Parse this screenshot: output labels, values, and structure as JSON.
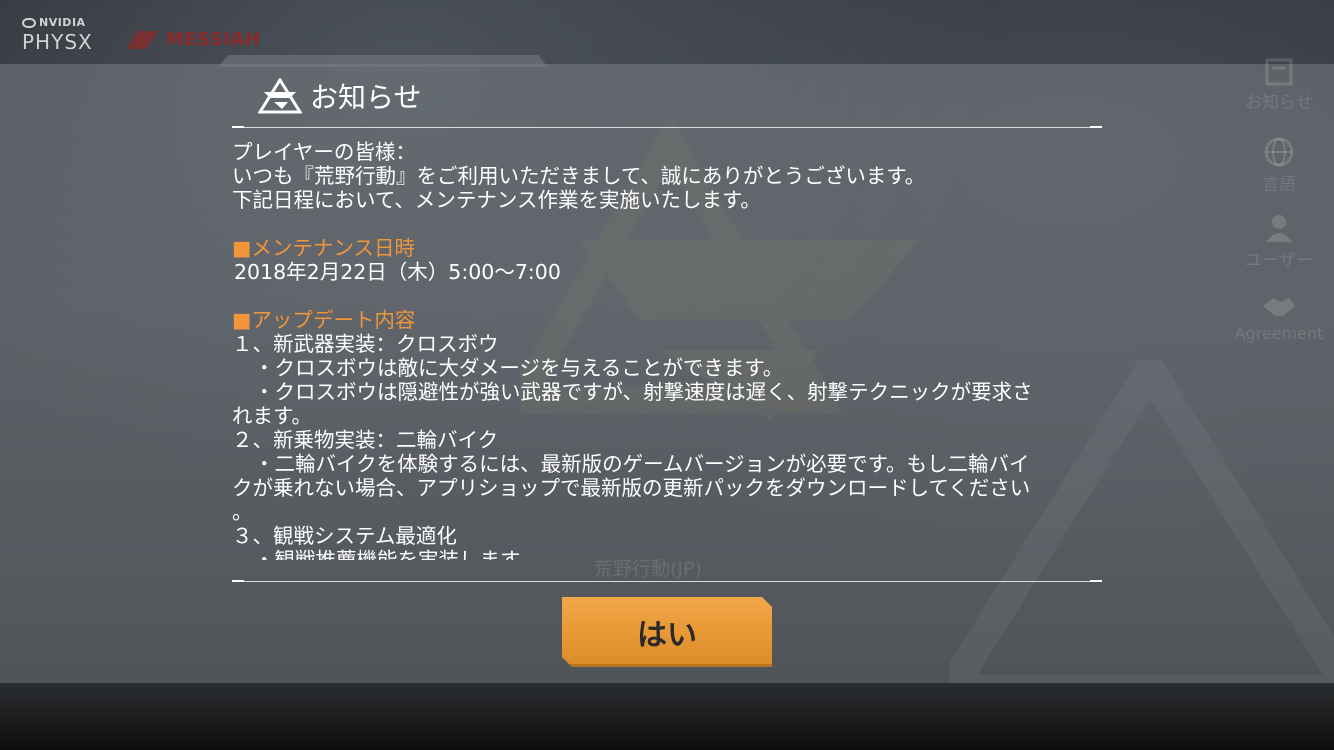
{
  "brand": {
    "nvidia_label": "NVIDIA",
    "physx_label": "PHYSX",
    "messiah_label": "MESSIAH"
  },
  "sidebar": {
    "items": [
      {
        "label": "お知らせ",
        "icon": "notice-icon"
      },
      {
        "label": "言語",
        "icon": "globe-icon"
      },
      {
        "label": "ユーザー",
        "icon": "user-icon"
      },
      {
        "label": "Agreement",
        "icon": "handshake-icon"
      }
    ]
  },
  "background": {
    "server_label": "荒野行動(JP)",
    "game_logo_text": "荒野行動"
  },
  "dialog": {
    "title": "お知らせ",
    "greeting": "プレイヤーの皆様：",
    "intro_line1": "いつも『荒野行動』をご利用いただきまして、誠にありがとうございます。",
    "intro_line2": "下記日程において、メンテナンス作業を実施いたします。",
    "maintenance_heading": "■メンテナンス日時",
    "maintenance_time": "2018年2月22日（木）5:00〜7:00",
    "update_heading": "■アップデート内容",
    "item1_title": "１、新武器実装：クロスボウ",
    "item1_line1": "・クロスボウは敵に大ダメージを与えることができます。",
    "item1_line2a": "・クロスボウは隠避性が強い武器ですが、射撃速度は遅く、射撃テクニックが要求さ",
    "item1_line2b": "れます。",
    "item2_title": "２、新乗物実装：二輪バイク",
    "item2_line1a": "・二輪バイクを体験するには、最新版のゲームバージョンが必要です。もし二輪バイ",
    "item2_line1b": "クが乗れない場合、アプリショップで最新版の更新パックをダウンロードしてください",
    "item2_line1c": "。",
    "item3_title": "３、観戦システム最適化",
    "item3_line1": "・観戦推薦機能を実装します",
    "confirm_label": "はい"
  },
  "colors": {
    "accent_orange": "#f0953a",
    "button_orange": "#e79733",
    "text_white": "#ffffff"
  }
}
